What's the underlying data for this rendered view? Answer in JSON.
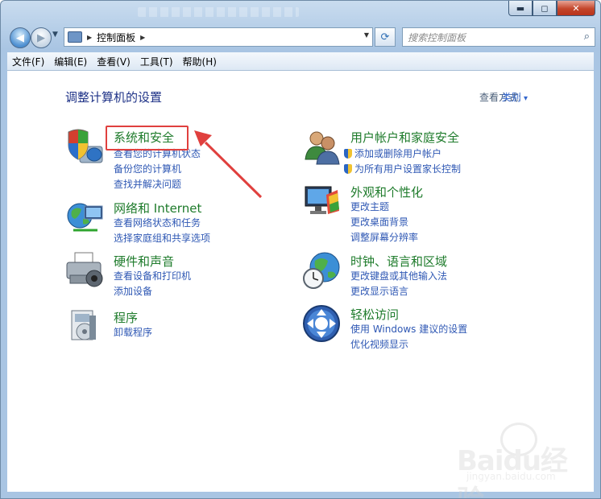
{
  "window": {
    "controls": {
      "minimize": "▬",
      "maximize": "◻",
      "close": "✕"
    }
  },
  "address": {
    "path": "控制面板",
    "search_placeholder": "搜索控制面板"
  },
  "menu": [
    "文件(F)",
    "编辑(E)",
    "查看(V)",
    "工具(T)",
    "帮助(H)"
  ],
  "content": {
    "heading": "调整计算机的设置",
    "view_by_label": "查看方式:",
    "view_by_value": "类别"
  },
  "categories": [
    {
      "title": "系统和安全",
      "links": [
        "查看您的计算机状态",
        "备份您的计算机",
        "查找并解决问题"
      ],
      "icon": "shield-pc-icon",
      "highlighted": true
    },
    {
      "title": "用户帐户和家庭安全",
      "links": [
        "添加或删除用户帐户",
        "为所有用户设置家长控制"
      ],
      "icon": "users-icon",
      "shield_links": true
    },
    {
      "title": "网络和 Internet",
      "links": [
        "查看网络状态和任务",
        "选择家庭组和共享选项"
      ],
      "icon": "network-icon"
    },
    {
      "title": "外观和个性化",
      "links": [
        "更改主题",
        "更改桌面背景",
        "调整屏幕分辨率"
      ],
      "icon": "appearance-icon"
    },
    {
      "title": "硬件和声音",
      "links": [
        "查看设备和打印机",
        "添加设备"
      ],
      "icon": "printer-icon"
    },
    {
      "title": "时钟、语言和区域",
      "links": [
        "更改键盘或其他输入法",
        "更改显示语言"
      ],
      "icon": "globe-clock-icon"
    },
    {
      "title": "程序",
      "links": [
        "卸载程序"
      ],
      "icon": "programs-icon"
    },
    {
      "title": "轻松访问",
      "links": [
        "使用 Windows 建议的设置",
        "优化视频显示"
      ],
      "icon": "ease-of-access-icon"
    }
  ],
  "watermark": {
    "brand": "Baidu经验",
    "url": "jingyan.baidu.com"
  }
}
